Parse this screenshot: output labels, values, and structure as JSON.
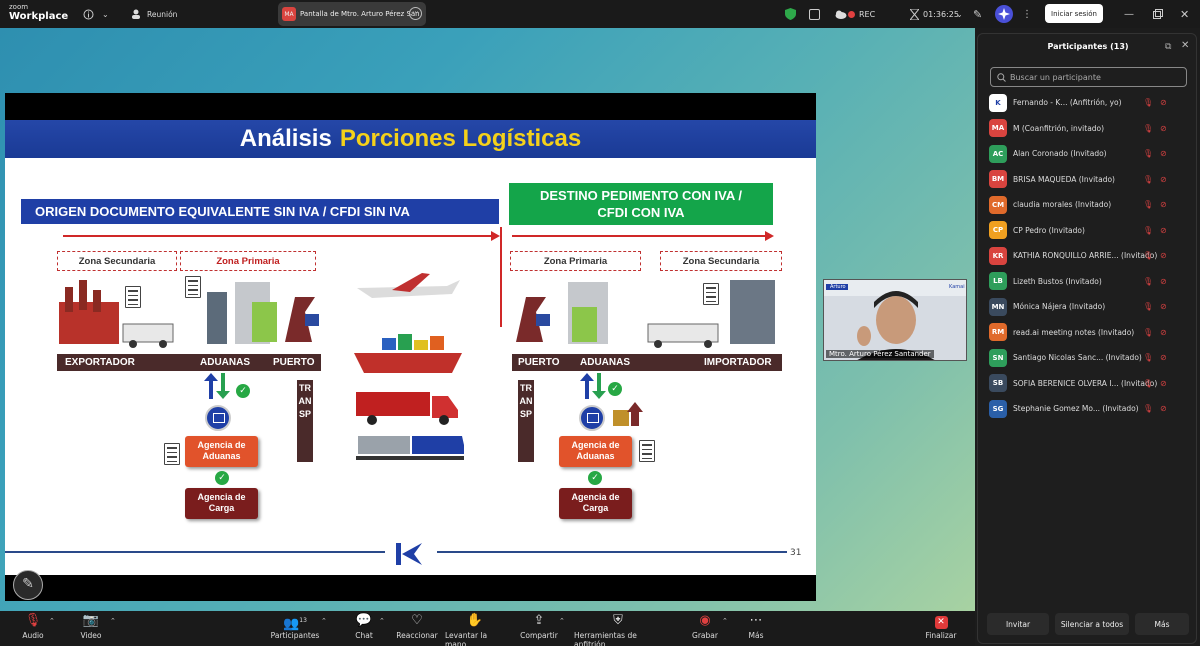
{
  "app": {
    "logo_line1": "zoom",
    "logo_line2": "Workplace"
  },
  "topbar": {
    "meeting_label": "Reunión",
    "share_badge": "MA",
    "share_title": "Pantalla de Mtro. Arturo Pérez San",
    "rec_label": "REC",
    "timer": "01:36:25",
    "login_button": "Iniciar sesión"
  },
  "slide": {
    "title_part1": "Análisis",
    "title_part2": "Porciones Logísticas",
    "origin_header": "ORIGEN  DOCUMENTO EQUIVALENTE SIN IVA / CFDI SIN IVA",
    "dest_header_line1": "DESTINO PEDIMENTO CON IVA /",
    "dest_header_line2": "CFDI CON IVA",
    "zones": [
      "Zona Secundaria",
      "Zona Primaria",
      "Zona Primaria",
      "Zona Secundaria"
    ],
    "left_bar": [
      "EXPORTADOR",
      "ADUANAS",
      "PUERTO"
    ],
    "right_bar": [
      "PUERTO",
      "ADUANAS",
      "IMPORTADOR"
    ],
    "transp": "TRANSP",
    "agency_customs_l1": "Agencia de",
    "agency_customs_l2": "Aduanas",
    "agency_cargo_l1": "Agencia de",
    "agency_cargo_l2": "Carga",
    "page_number": "31"
  },
  "video": {
    "name": "Mtro. Arturo Pérez Santander",
    "tag": "Arturo",
    "brand": "Kamai"
  },
  "panel": {
    "title": "Participantes (13)",
    "search_placeholder": "Buscar un participante",
    "participants": [
      {
        "initials": "K",
        "name": "Fernando - K... (Anfitrión, yo)",
        "color": "#ffffff"
      },
      {
        "initials": "MA",
        "name": "M (Coanfitrión, invitado)",
        "color": "#d9443f"
      },
      {
        "initials": "AC",
        "name": "Alan Coronado (Invitado)",
        "color": "#2e9e5b"
      },
      {
        "initials": "BM",
        "name": "BRISA MAQUEDA (Invitado)",
        "color": "#d9443f"
      },
      {
        "initials": "CM",
        "name": "claudia morales (Invitado)",
        "color": "#e06a2b"
      },
      {
        "initials": "CP",
        "name": "CP Pedro (Invitado)",
        "color": "#f0a020"
      },
      {
        "initials": "KR",
        "name": "KATHIA RONQUILLO ARRIE...  (Invitado)",
        "color": "#d9443f"
      },
      {
        "initials": "LB",
        "name": "Lizeth Bustos (Invitado)",
        "color": "#2e9e5b"
      },
      {
        "initials": "MN",
        "name": "Mónica Nájera (Invitado)",
        "color": "#3a4a5e"
      },
      {
        "initials": "RM",
        "name": "read.ai meeting notes (Invitado)",
        "color": "#e06a2b"
      },
      {
        "initials": "SN",
        "name": "Santiago Nicolas Sanc...  (Invitado)",
        "color": "#2e9e5b"
      },
      {
        "initials": "SB",
        "name": "SOFIA BERENICE OLVERA I...  (Invitado)",
        "color": "#3a4a5e"
      },
      {
        "initials": "SG",
        "name": "Stephanie Gomez Mo...  (Invitado)",
        "color": "#2a5fa8"
      }
    ],
    "invite": "Invitar",
    "mute_all": "Silenciar a todos",
    "more": "Más"
  },
  "toolbar": {
    "audio": "Audio",
    "video": "Video",
    "participants": "Participantes",
    "participants_count": "13",
    "chat": "Chat",
    "react": "Reaccionar",
    "raise_hand": "Levantar la mano",
    "share": "Compartir",
    "host_tools": "Herramientas de anfitrión",
    "record": "Grabar",
    "more": "Más",
    "end": "Finalizar"
  },
  "colors": {
    "accent_red": "#d02828",
    "header_blue": "#1f3fa6",
    "header_green": "#14a54a",
    "title_yellow": "#f4d11a"
  }
}
